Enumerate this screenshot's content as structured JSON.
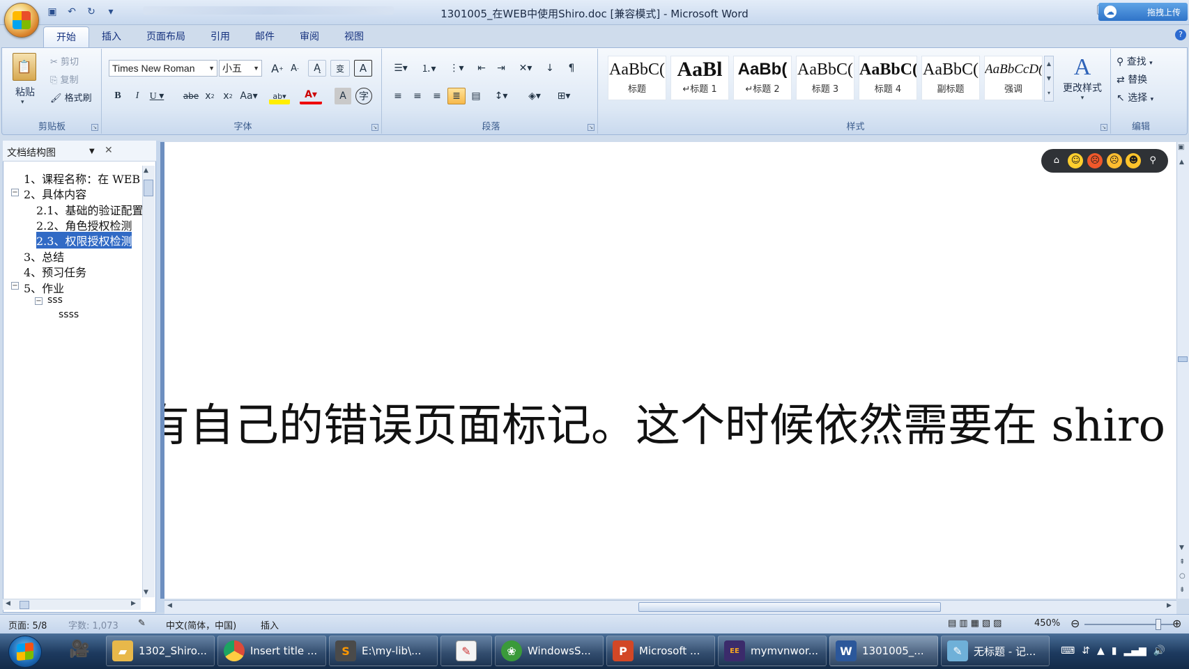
{
  "window": {
    "title": "1301005_在WEB中使用Shiro.doc [兼容模式] - Microsoft Word",
    "upload_label": "拖拽上传"
  },
  "quick_access": [
    {
      "icon": "save-icon"
    },
    {
      "icon": "undo-icon"
    },
    {
      "icon": "redo-icon"
    },
    {
      "icon": "customize-icon"
    }
  ],
  "tabs": [
    {
      "label": "开始",
      "active": true
    },
    {
      "label": "插入"
    },
    {
      "label": "页面布局"
    },
    {
      "label": "引用"
    },
    {
      "label": "邮件"
    },
    {
      "label": "审阅"
    },
    {
      "label": "视图"
    }
  ],
  "clipboard": {
    "group": "剪贴板",
    "paste": "粘贴",
    "cut": "剪切",
    "copy": "复制",
    "format_painter": "格式刷"
  },
  "font": {
    "group": "字体",
    "family": "Times New Roman",
    "size": "小五"
  },
  "paragraph": {
    "group": "段落"
  },
  "styles": {
    "group": "样式",
    "items": [
      {
        "sample": "AaBbC(",
        "name": "标题"
      },
      {
        "sample": "AaBl",
        "name": "↵标题 1"
      },
      {
        "sample": "AaBb(",
        "name": "↵标题 2"
      },
      {
        "sample": "AaBbC(",
        "name": "标题 3"
      },
      {
        "sample": "AaBbC(",
        "name": "标题 4"
      },
      {
        "sample": "AaBbC(",
        "name": "副标题"
      },
      {
        "sample": "AaBbCcD(",
        "name": "强调"
      }
    ],
    "change_styles": "更改样式"
  },
  "editing": {
    "group": "编辑",
    "find": "查找",
    "replace": "替换",
    "select": "选择"
  },
  "nav_pane": {
    "title": "文档结构图",
    "items": [
      {
        "text": "1、课程名称：在 WEB",
        "level": 1
      },
      {
        "text": "2、具体内容",
        "level": 1,
        "toggle": "⊟"
      },
      {
        "text": "2.1、基础的验证配置",
        "level": 2
      },
      {
        "text": "2.2、角色授权检测",
        "level": 2
      },
      {
        "text": "2.3、权限授权检测",
        "level": 2,
        "selected": true
      },
      {
        "text": "3、总结",
        "level": 1
      },
      {
        "text": "4、预习任务",
        "level": 1
      },
      {
        "text": "5、作业",
        "level": 1,
        "toggle": "⊟"
      },
      {
        "text": "sss",
        "level": 2,
        "toggle": "⊟"
      },
      {
        "text": "ssss",
        "level": 3
      }
    ]
  },
  "document": {
    "visible_text": "有自己的错误页面标记。这个时候依然需要在 shiro"
  },
  "emoji_bar": [
    "home-icon",
    "smile-icon",
    "angry-icon",
    "cry-icon",
    "tongue-icon",
    "search-icon"
  ],
  "status": {
    "page": "页面: 5/8",
    "words": "字数: 1,073",
    "language": "中文(简体，中国)",
    "mode": "插入",
    "zoom": "450%"
  },
  "taskbar": [
    {
      "label": "1302_Shiro...",
      "icon": "folder-icon",
      "color": "#e8b84a"
    },
    {
      "label": "Insert title ...",
      "icon": "chrome-icon",
      "color": "#dd4b39"
    },
    {
      "label": "E:\\my-lib\\...",
      "icon": "sublime-icon",
      "color": "#4a4a4a"
    },
    {
      "label": "",
      "icon": "notepad-icon",
      "color": "#c33"
    },
    {
      "label": "WindowsS...",
      "icon": "windows-icon",
      "color": "#3a9a3a"
    },
    {
      "label": "Microsoft ...",
      "icon": "powerpoint-icon",
      "color": "#d24726"
    },
    {
      "label": "mymvnwor...",
      "icon": "eclipse-icon",
      "color": "#3b2b6b"
    },
    {
      "label": "1301005_...",
      "icon": "word-icon",
      "color": "#2b579a"
    },
    {
      "label": "无标题 - 记...",
      "icon": "notepad-icon",
      "color": "#6fb0d8"
    }
  ]
}
